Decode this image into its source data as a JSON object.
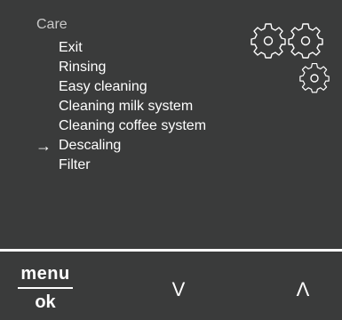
{
  "menu": {
    "section_title": "Care",
    "items": [
      {
        "label": "Exit",
        "selected": false
      },
      {
        "label": "Rinsing",
        "selected": false
      },
      {
        "label": "Easy cleaning",
        "selected": false
      },
      {
        "label": "Cleaning milk system",
        "selected": false
      },
      {
        "label": "Cleaning coffee system",
        "selected": false
      },
      {
        "label": "Descaling",
        "selected": true
      },
      {
        "label": "Filter",
        "selected": false
      }
    ],
    "selection_indicator": "→",
    "decoration_icon": "gears-icon"
  },
  "controls": {
    "menu_label": "menu",
    "ok_label": "ok",
    "down_label": "V",
    "up_label": "Λ"
  },
  "colors": {
    "screen_background": "#3a3b3b",
    "text_primary": "#ffffff",
    "text_secondary": "#c9c9c9"
  }
}
